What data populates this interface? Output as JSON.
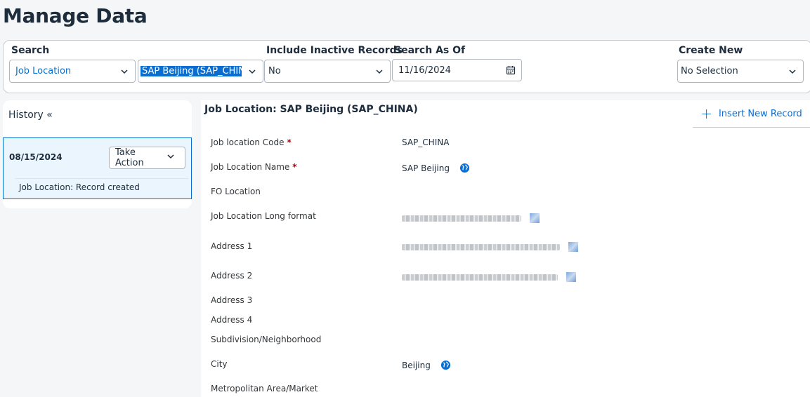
{
  "page": {
    "title": "Manage Data"
  },
  "search": {
    "label": "Search",
    "object_type": "Job Location",
    "object_value": "SAP Beijing (SAP_CHINA",
    "include_inactive_label": "Include Inactive Records",
    "include_inactive_value": "No",
    "as_of_label": "Search As Of",
    "as_of_value": "11/16/2024",
    "create_new_label": "Create New",
    "create_new_value": "No Selection"
  },
  "history": {
    "title": "History «",
    "entries": [
      {
        "date": "08/15/2024",
        "action_label": "Take Action",
        "description": "Job Location: Record created"
      }
    ]
  },
  "detail": {
    "title": "Job Location: SAP Beijing (SAP_CHINA)",
    "insert_label": "Insert New Record",
    "fields": [
      {
        "label": "Job location Code",
        "required": "*",
        "value": "SAP_CHINA"
      },
      {
        "label": "Job Location Name",
        "required": "*",
        "value": "SAP Beijing"
      },
      {
        "label": "FO Location",
        "value": ""
      },
      {
        "label": "Job Location Long format",
        "value": ""
      },
      {
        "label": "Address 1",
        "value": ""
      },
      {
        "label": "Address 2",
        "value": ""
      },
      {
        "label": "Address 3",
        "value": ""
      },
      {
        "label": "Address 4",
        "value": ""
      },
      {
        "label": "Subdivision/Neighborhood",
        "value": ""
      },
      {
        "label": "City",
        "value": "Beijing"
      },
      {
        "label": "Metropolitan Area/Market",
        "value": ""
      }
    ]
  },
  "colors": {
    "accent": "#0a6ed1",
    "required": "#bb0000",
    "background": "#f5f6f7"
  },
  "icons": {
    "dropdown": "chevron-down-icon",
    "calendar": "calendar-icon",
    "translation": "globe-icon",
    "add": "plus-icon"
  }
}
